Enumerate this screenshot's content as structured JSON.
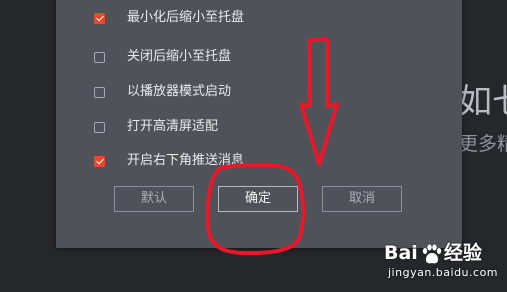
{
  "background": {
    "text_large": "如七",
    "text_small": "更多精"
  },
  "dialog": {
    "options": [
      {
        "label": "最小化后缩小至托盘",
        "checked": true
      },
      {
        "label": "关闭后缩小至托盘",
        "checked": false
      },
      {
        "label": "以播放器模式启动",
        "checked": false
      },
      {
        "label": "打开高清屏适配",
        "checked": false
      },
      {
        "label": "开启右下角推送消息",
        "checked": true
      }
    ],
    "buttons": {
      "default_label": "默认",
      "confirm_label": "确定",
      "cancel_label": "取消"
    }
  },
  "annotations": {
    "arrow_color": "#e8182a",
    "highlight_color": "#e8182a",
    "arrow_icon": "down-arrow-icon",
    "highlight_target": "confirm-button"
  },
  "watermark": {
    "brand_left": "Bai",
    "brand_right": "经验",
    "url": "jingyan.baidu.com",
    "icon": "paw-icon"
  },
  "colors": {
    "accent": "#e8492f",
    "dialog_bg": "#4f5259",
    "page_bg": "#26272b"
  }
}
